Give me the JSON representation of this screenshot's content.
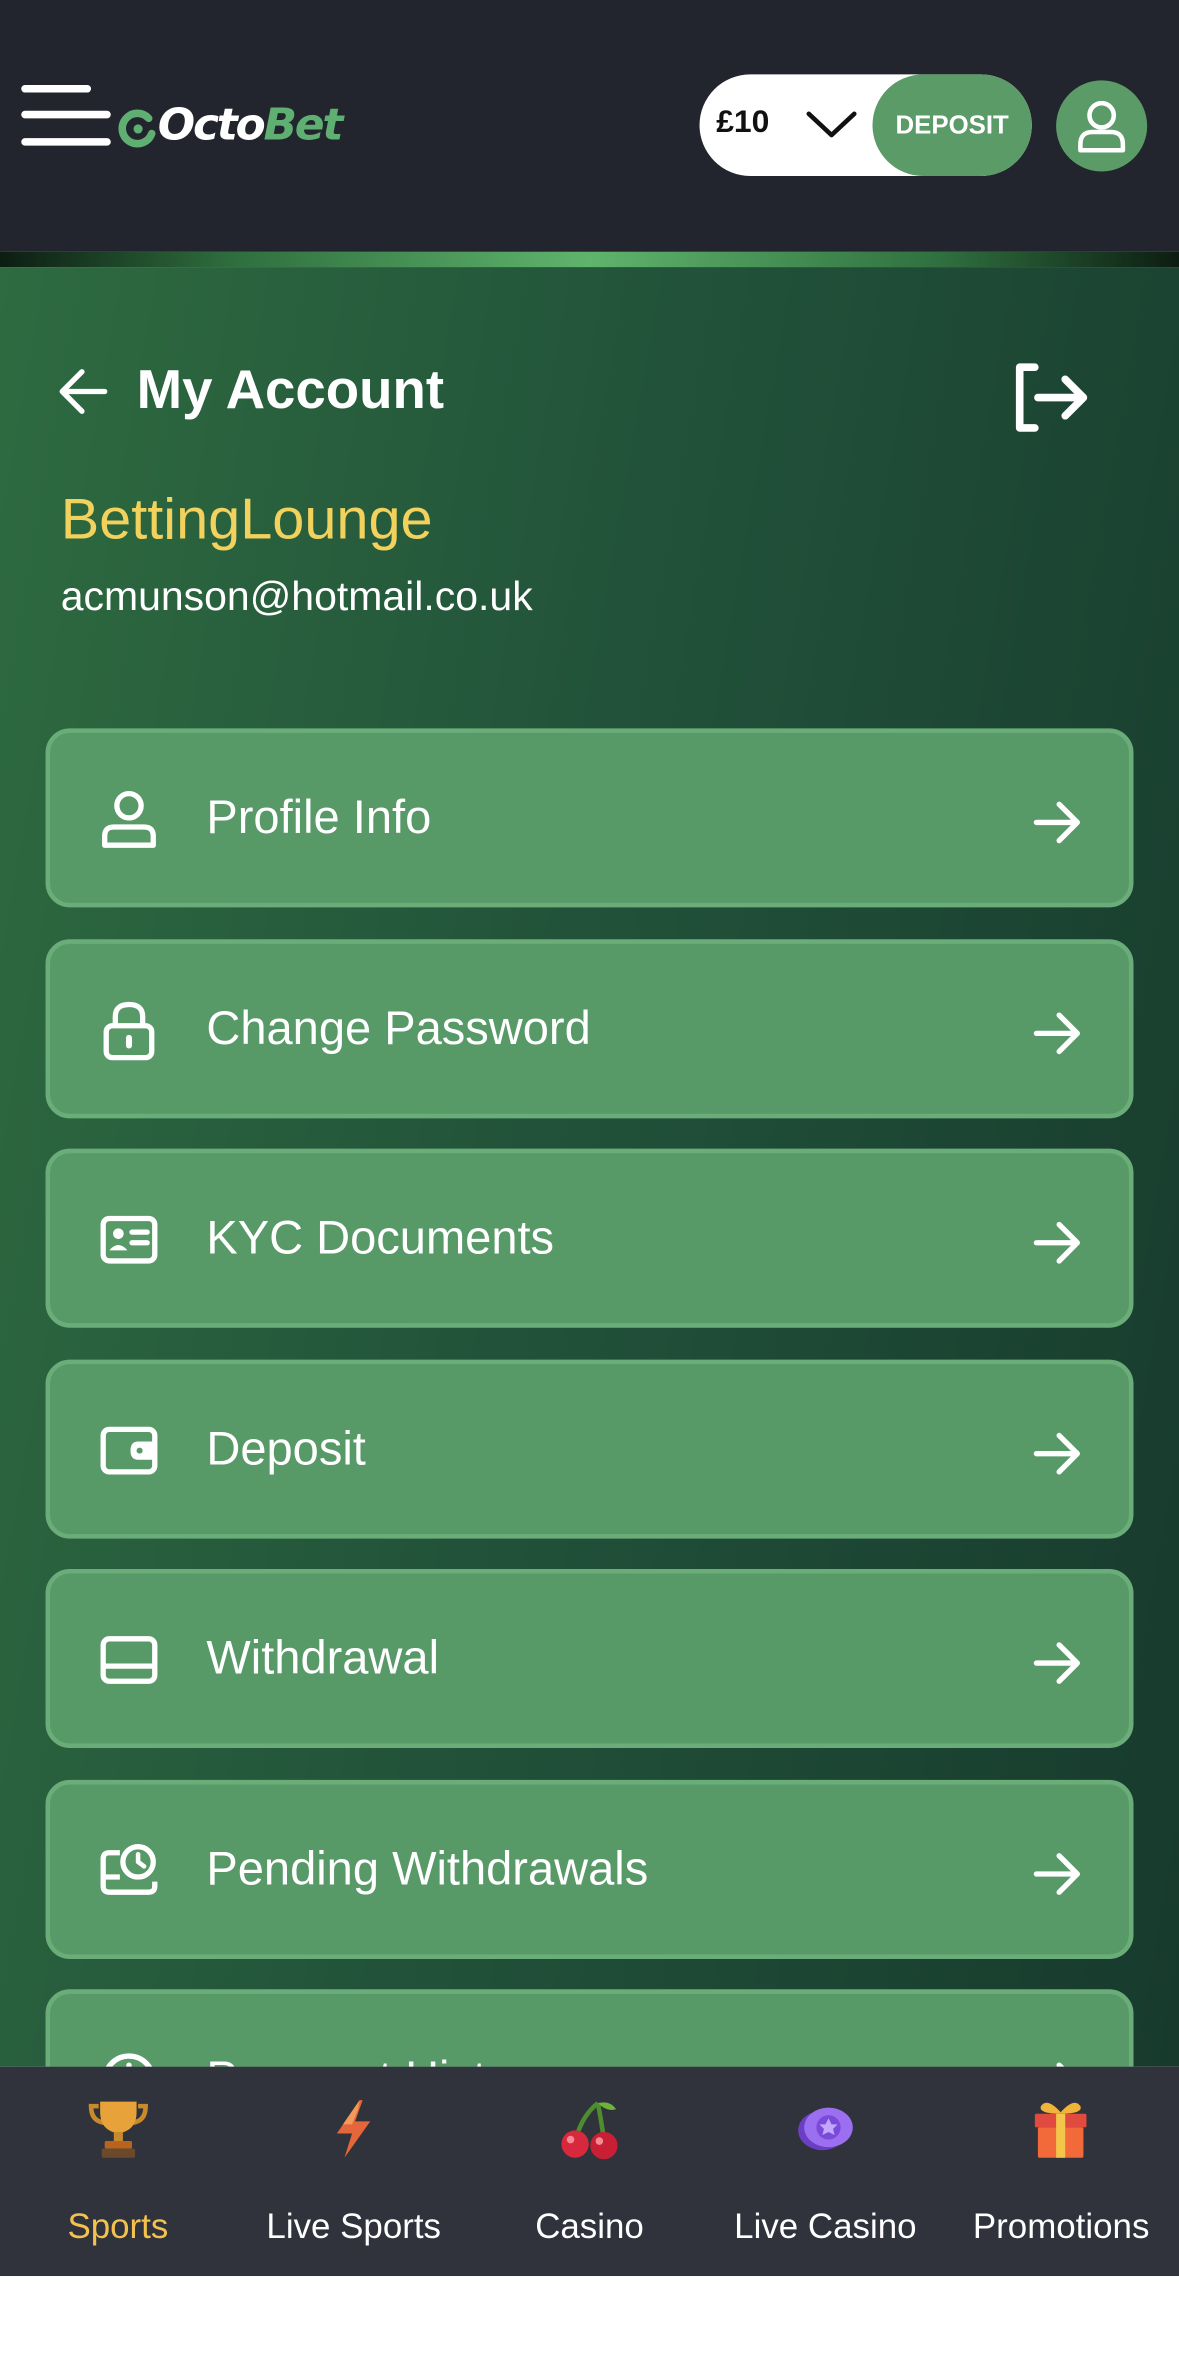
{
  "header": {
    "menu_icon": "hamburger-icon",
    "logo_part1": "Octo",
    "logo_part2": "Bet",
    "balance": "£10",
    "balance_icon": "chevron-down-icon",
    "deposit_label": "DEPOSIT",
    "account_icon": "user-icon"
  },
  "account": {
    "back_icon": "arrow-left-icon",
    "title": "My Account",
    "logout_icon": "logout-icon",
    "username": "BettingLounge",
    "email": "acmunson@hotmail.co.uk"
  },
  "menu": [
    {
      "label": "Profile Info",
      "icon": "user-icon"
    },
    {
      "label": "Change Password",
      "icon": "lock-icon"
    },
    {
      "label": "KYC Documents",
      "icon": "id-card-icon"
    },
    {
      "label": "Deposit",
      "icon": "wallet-icon"
    },
    {
      "label": "Withdrawal",
      "icon": "card-icon"
    },
    {
      "label": "Pending Withdrawals",
      "icon": "pending-clock-icon"
    },
    {
      "label": "Payment History",
      "icon": "history-clock-icon"
    }
  ],
  "bottom_nav": [
    {
      "label": "Sports",
      "icon": "trophy-icon",
      "active": true
    },
    {
      "label": "Live Sports",
      "icon": "lightning-icon",
      "active": false
    },
    {
      "label": "Casino",
      "icon": "cherries-icon",
      "active": false
    },
    {
      "label": "Live Casino",
      "icon": "casino-chip-icon",
      "active": false
    },
    {
      "label": "Promotions",
      "icon": "gift-icon",
      "active": false
    }
  ],
  "colors": {
    "header_bg": "#22252d",
    "brand_green": "#5a9b68",
    "menu_item_bg": "#589968",
    "username_yellow": "#f2d15c",
    "nav_bg": "#30333b",
    "nav_active": "#f2c14e"
  }
}
